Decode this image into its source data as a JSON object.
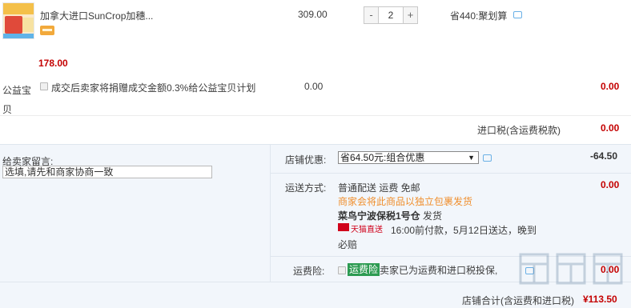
{
  "item": {
    "title": "加拿大进口SunCrop加穗...",
    "unit_price": "309.00",
    "quantity": "2",
    "qty_minus": "-",
    "qty_plus": "+",
    "savings": "省440:聚划算",
    "price_red": "178.00"
  },
  "charity": {
    "label": "公益宝贝",
    "text": "成交后卖家将捐赠成交金额0.3%给公益宝贝计划",
    "unit": "0.00",
    "amount": "0.00"
  },
  "import_tax": {
    "label": "进口税(含运费税款)",
    "amount": "0.00"
  },
  "seller_note": {
    "label": "给卖家留言:",
    "value": "选填,请先和商家协商一致"
  },
  "shop_discount": {
    "label": "店铺优惠:",
    "selected": "省64.50元:组合优惠",
    "amount": "-64.50"
  },
  "shipping": {
    "label": "运送方式:",
    "line1": "普通配送 运费 免邮",
    "line2": "商家会将此商品以独立包裹发货",
    "warehouse": "菜鸟宁波保税1号仓",
    "warehouse_suffix": "发货",
    "tmall_badge": "天猫直送",
    "delivery": "16:00前付款，5月12日送达，晚到",
    "compensation": "必赔",
    "amount": "0.00"
  },
  "insurance": {
    "label": "运费险:",
    "tag": "运费险",
    "text": "卖家已为运费和进口税投保,",
    "amount": "0.00"
  },
  "total": {
    "label": "店铺合计(含运费和进口税)",
    "amount": "¥113.50"
  },
  "colors": {
    "accent_red": "#c40000",
    "orange": "#f08e2c",
    "insurance_green": "#2d9b52"
  }
}
